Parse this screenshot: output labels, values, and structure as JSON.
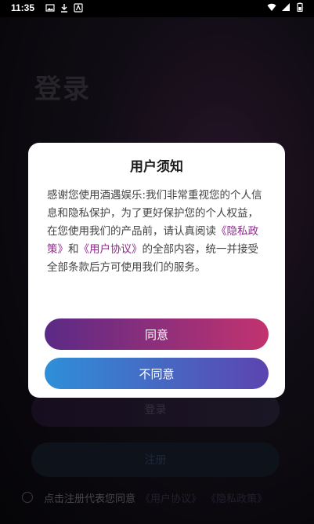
{
  "status_bar": {
    "time": "11:35"
  },
  "background": {
    "title": "登录",
    "login_button": "登录",
    "register_button": "注册",
    "agreement_prefix": "点击注册代表您同意",
    "user_agreement_link": "《用户协议》",
    "privacy_link": "《隐私政策》"
  },
  "dialog": {
    "title": "用户须知",
    "body_part1": "感谢您使用酒遇娱乐:我们非常重视您的个人信息和隐私保护，为了更好保护您的个人权益，在您使用我们的产品前，请认真阅读",
    "privacy_link": "《隐私政策》",
    "body_and": "和",
    "user_agreement_link": "《用户协议》",
    "body_part2": "的全部内容，统一并接受全部条款后方可使用我们的服务。",
    "agree_button": "同意",
    "disagree_button": "不同意"
  },
  "colors": {
    "agree_gradient": [
      "#5a2a86",
      "#c2336f"
    ],
    "disagree_gradient": [
      "#2f8fd8",
      "#5c44b0"
    ],
    "link": "#8b2a8a"
  }
}
